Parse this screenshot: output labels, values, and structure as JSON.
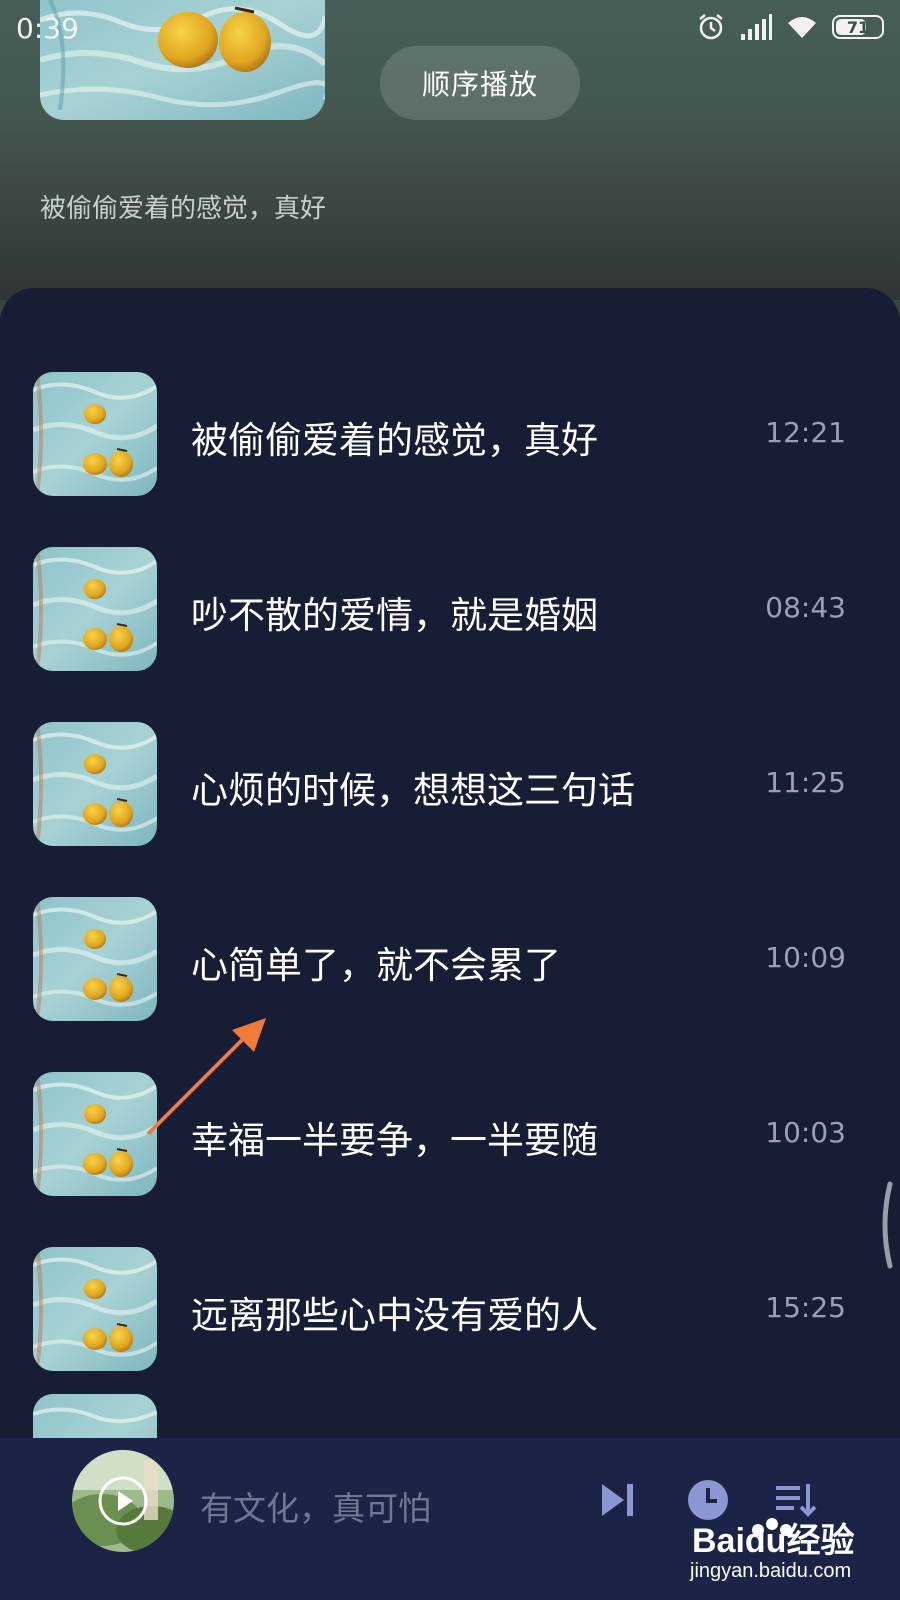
{
  "status_bar": {
    "time": "0:39",
    "battery": "71",
    "battery_level": 0.71,
    "icons": [
      "alarm-icon",
      "signal-icon",
      "wifi-icon",
      "battery-icon"
    ]
  },
  "header": {
    "play_mode_label": "顺序播放",
    "subtitle": "被偷偷爱着的感觉，真好"
  },
  "tracks": [
    {
      "title": "被偷偷爱着的感觉，真好",
      "duration": "12:21"
    },
    {
      "title": "吵不散的爱情，就是婚姻",
      "duration": "08:43"
    },
    {
      "title": "心烦的时候，想想这三句话",
      "duration": "11:25"
    },
    {
      "title": "心简单了，就不会累了",
      "duration": "10:09"
    },
    {
      "title": "幸福一半要争，一半要随",
      "duration": "10:03"
    },
    {
      "title": "远离那些心中没有爱的人",
      "duration": "15:25"
    }
  ],
  "player": {
    "now_playing": "有文化，真可怕",
    "icons": [
      "play-icon",
      "next-track-icon",
      "timer-icon",
      "playlist-icon"
    ]
  },
  "watermark": {
    "brand": "Baidu经验",
    "url": "jingyan.baidu.com"
  },
  "colors": {
    "panel_bg": "#161d34",
    "player_bg": "#1b2347",
    "annotation_arrow": "#f07a3a"
  }
}
